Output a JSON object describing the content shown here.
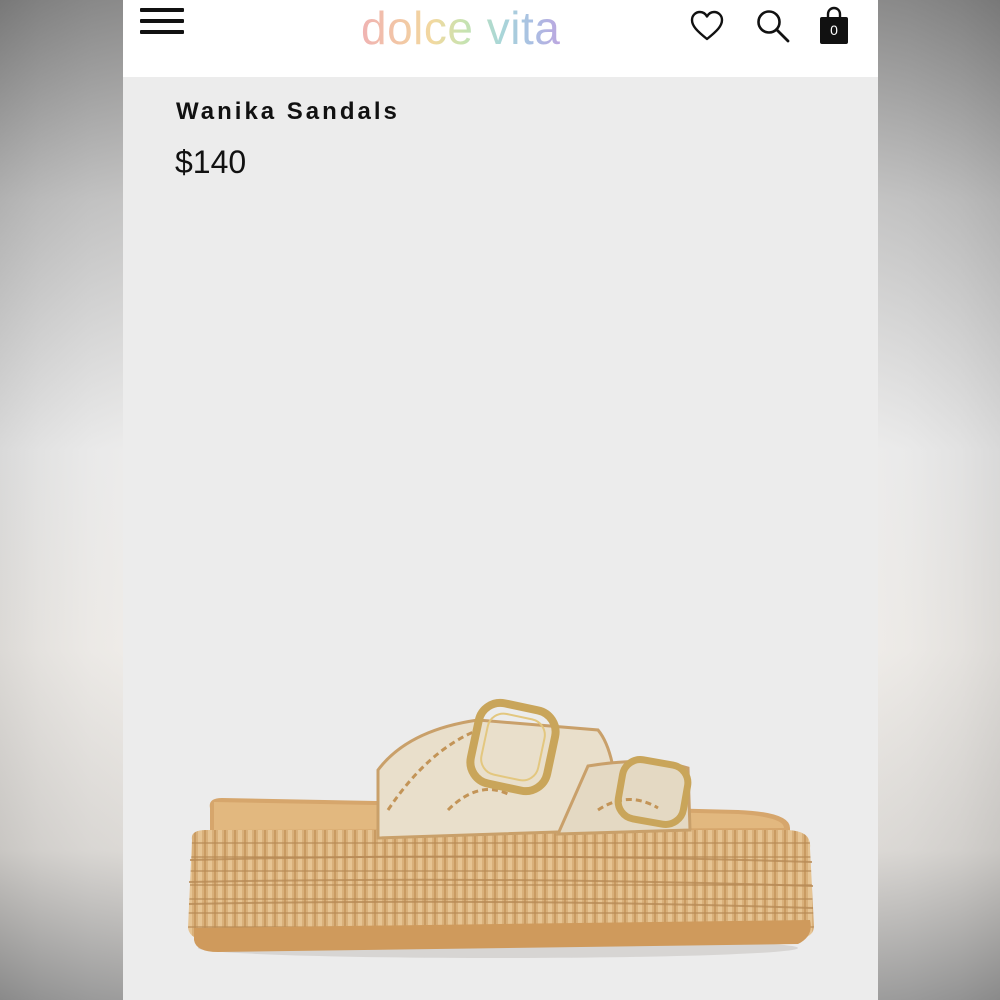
{
  "header": {
    "logo_text": "dolce vita",
    "bag_count": "0",
    "icons": {
      "menu": "hamburger-menu-icon",
      "wishlist": "heart-icon",
      "search": "search-icon",
      "bag": "shopping-bag-icon"
    }
  },
  "product": {
    "title": "Wanika Sandals",
    "price": "$140",
    "image": "product-image-sandal"
  },
  "colors": {
    "background": "#ececec",
    "header_bg": "#ffffff",
    "text": "#111111"
  }
}
